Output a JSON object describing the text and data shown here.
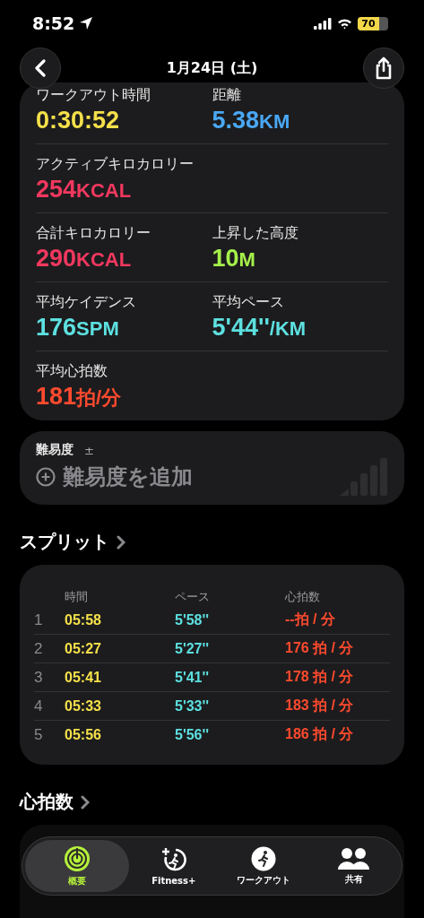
{
  "status_bar": {
    "time": "8:52",
    "battery": "70"
  },
  "nav": {
    "title": "1月24日 (土)"
  },
  "metrics": [
    [
      {
        "label": "ワークアウト時間",
        "value": "0:30:52",
        "color": "#f5e04a"
      },
      {
        "label": "距離",
        "value": "5.38",
        "unit": "KM",
        "color": "#4aa8f5"
      }
    ],
    [
      {
        "label": "アクティブキロカロリー",
        "value": "254",
        "unit": "KCAL",
        "color": "#f2385f"
      }
    ],
    [
      {
        "label": "合計キロカロリー",
        "value": "290",
        "unit": "KCAL",
        "color": "#f2385f"
      },
      {
        "label": "上昇した高度",
        "value": "10",
        "unit": "M",
        "color": "#a6f04a"
      }
    ],
    [
      {
        "label": "平均ケイデンス",
        "value": "176",
        "unit": "SPM",
        "color": "#5de0e0"
      },
      {
        "label": "平均ペース",
        "value": "5'44''",
        "unit": "/KM",
        "color": "#5de0e0"
      }
    ],
    [
      {
        "label": "平均心拍数",
        "value": "181",
        "unit": "拍/分",
        "color": "#ff4a2e"
      }
    ]
  ],
  "difficulty": {
    "label": "難易度",
    "sign": "±",
    "action": "難易度を追加"
  },
  "splits": {
    "title": "スプリット",
    "columns": [
      "時間",
      "ペース",
      "心拍数"
    ],
    "rows": [
      {
        "index": "1",
        "time": "05:58",
        "pace": "5'58''",
        "hr": "--拍 / 分"
      },
      {
        "index": "2",
        "time": "05:27",
        "pace": "5'27''",
        "hr": "176 拍 / 分"
      },
      {
        "index": "3",
        "time": "05:41",
        "pace": "5'41''",
        "hr": "178 拍 / 分"
      },
      {
        "index": "4",
        "time": "05:33",
        "pace": "5'33''",
        "hr": "183 拍 / 分"
      },
      {
        "index": "5",
        "time": "05:56",
        "pace": "5'56''",
        "hr": "186 拍 / 分"
      }
    ]
  },
  "heart_rate": {
    "title": "心拍数"
  },
  "tab_bar": [
    {
      "label": "概要",
      "kind": "rings",
      "selected": true
    },
    {
      "label": "Fitness+",
      "kind": "fitness",
      "selected": false
    },
    {
      "label": "ワークアウト",
      "kind": "workout",
      "selected": false
    },
    {
      "label": "共有",
      "kind": "sharing",
      "selected": false
    }
  ]
}
